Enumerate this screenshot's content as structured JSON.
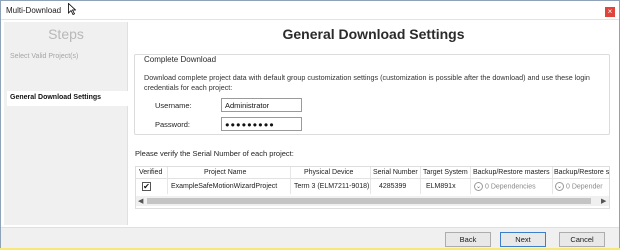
{
  "window": {
    "title": "Multi-Download",
    "close_glyph": "×"
  },
  "sidebar": {
    "title": "Steps",
    "items": [
      {
        "label": "Select Valid Project(s)",
        "state": "done"
      },
      {
        "label": "General Download Settings",
        "state": "active"
      }
    ]
  },
  "page": {
    "title": "General Download Settings"
  },
  "complete_download": {
    "title": "Complete Download",
    "description": "Download complete project data with default group customization settings (customization is possible after the download) and use these login credentials for each project:",
    "username": {
      "label": "Username:",
      "value": "Administrator"
    },
    "password": {
      "label": "Password:",
      "value": "●●●●●●●●●"
    }
  },
  "serial": {
    "prompt": "Please verify the Serial Number of each project:",
    "columns": [
      "Verified",
      "Project Name",
      "Physical Device",
      "Serial Number",
      "Target System",
      "Backup/Restore masters",
      "Backup/Restore s"
    ],
    "rows": [
      {
        "verified": true,
        "verified_glyph": "✔",
        "project_name": "ExampleSafeMotionWizardProject",
        "physical_device": "Term 3 (ELM7211-9018)",
        "serial_number": "4285399",
        "target_system": "ELM891x",
        "backup_masters": "0 Dependencies",
        "backup_s": "0 Depender"
      }
    ],
    "scroll": {
      "left": "◀",
      "right": "▶"
    }
  },
  "footer": {
    "back": "Back",
    "next": "Next",
    "cancel": "Cancel"
  },
  "icons": {
    "dependency_toggle": "chevron-down-icon",
    "dependency_glyph": "⌄"
  },
  "colors": {
    "close_button": "#e0443a",
    "accent_border": "#3c7fc8",
    "background_yellow": "#f6e97a"
  }
}
